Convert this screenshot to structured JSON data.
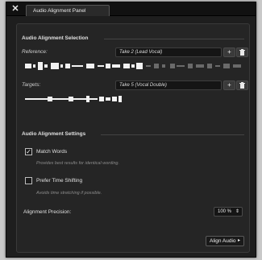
{
  "window": {
    "close_glyph": "✕",
    "tab_title": "Audio Alignment Panel"
  },
  "selection": {
    "title": "Audio Alignment Selection",
    "reference_label": "Reference:",
    "reference_value": "Take 2 (Lead Vocal)",
    "targets_label": "Targets:",
    "targets_value": "Take 5 (Vocal Double)",
    "add_glyph": "+",
    "delete_icon": "trash-icon"
  },
  "settings": {
    "title": "Audio Alignment Settings",
    "match_words": {
      "label": "Match Words",
      "checked": true,
      "hint": "Provides best results for identical wording."
    },
    "prefer_time_shifting": {
      "label": "Prefer Time Shifting",
      "checked": false,
      "hint": "Avoids time stretching if possible."
    },
    "precision_label": "Alignment Precision:",
    "precision_value": "100 %"
  },
  "actions": {
    "align_label": "Align Audio",
    "align_arrow": "▸"
  },
  "colors": {
    "background": "#1e1e1e",
    "panel": "#252525",
    "waveform_active": "#f2f2f2",
    "waveform_inactive": "#6a6a6a"
  }
}
